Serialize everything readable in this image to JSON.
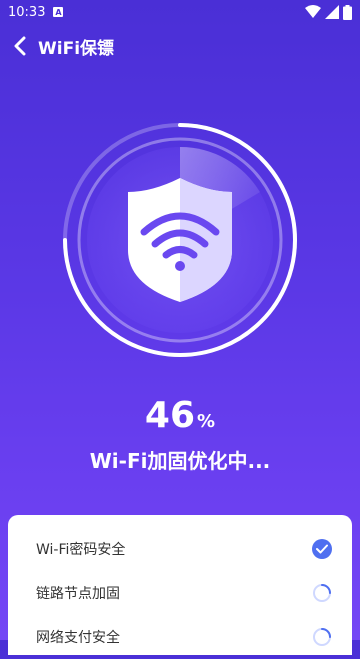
{
  "status_bar": {
    "time": "10:33",
    "notif_letter": "A"
  },
  "app_bar": {
    "title": "WiFi保镖"
  },
  "progress": {
    "value": "46",
    "unit": "%",
    "label": "Wi-Fi加固优化中..."
  },
  "tasks": [
    {
      "label": "Wi-Fi密码安全",
      "state": "done"
    },
    {
      "label": "链路节点加固",
      "state": "loading"
    },
    {
      "label": "网络支付安全",
      "state": "loading"
    }
  ],
  "colors": {
    "accent": "#4f6ff0",
    "bg_top": "#4a2fd6",
    "bg_bottom": "#7446f5"
  }
}
